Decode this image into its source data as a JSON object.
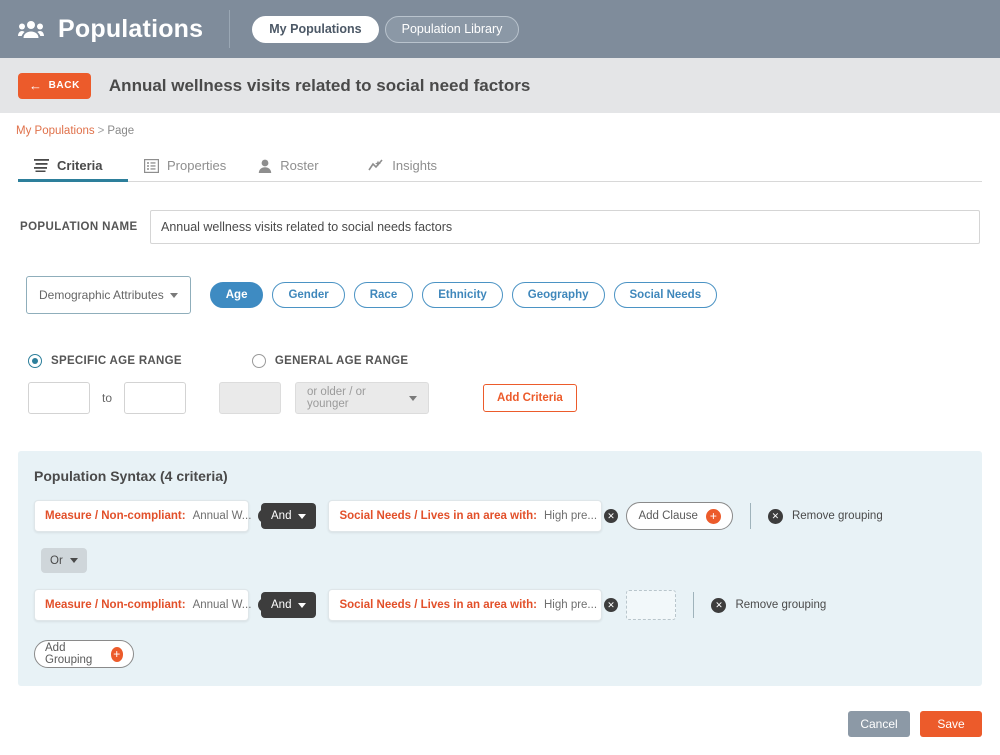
{
  "appbar": {
    "logo_icon": "people-group-icon",
    "title": "Populations",
    "segments": [
      {
        "label": "My Populations",
        "active": true
      },
      {
        "label": "Population Library",
        "active": false
      }
    ]
  },
  "subheader": {
    "back_label": "BACK",
    "back_icon": "arrow-left-icon",
    "page_title": "Annual wellness visits related to social need factors"
  },
  "breadcrumb": {
    "root": "My Populations",
    "separator": ">",
    "current": "Page"
  },
  "tabs": [
    {
      "label": "Criteria",
      "icon": "criteria-lines-icon",
      "active": true
    },
    {
      "label": "Properties",
      "icon": "list-box-icon",
      "active": false
    },
    {
      "label": "Roster",
      "icon": "person-icon",
      "active": false
    },
    {
      "label": "Insights",
      "icon": "trend-chart-icon",
      "active": false
    }
  ],
  "population_name": {
    "label": "POPULATION NAME",
    "value": "Annual wellness visits related to social needs factors",
    "placeholder": "Population name"
  },
  "attributes": {
    "selector_label": "Demographic  Attributes",
    "selector_icon": "chevron-down-icon",
    "pills": [
      {
        "label": "Age",
        "selected": true
      },
      {
        "label": "Gender",
        "selected": false
      },
      {
        "label": "Race",
        "selected": false
      },
      {
        "label": "Ethnicity",
        "selected": false
      },
      {
        "label": "Geography",
        "selected": false
      },
      {
        "label": "Social Needs",
        "selected": false
      }
    ]
  },
  "age_range": {
    "specific_label": "SPECIFIC AGE RANGE",
    "specific_selected": true,
    "general_label": "GENERAL AGE RANGE",
    "general_selected": false,
    "from_value": "",
    "from_placeholder": "",
    "to_label": "to",
    "to_value": "",
    "to_placeholder": "",
    "general_value": "",
    "general_select_label": "or older / or younger",
    "add_criteria_label": "Add Criteria"
  },
  "syntax": {
    "title": "Population Syntax (4 criteria)",
    "groups": [
      {
        "clauses": [
          {
            "category": "Measure / Non-compliant:",
            "value": "Annual W...",
            "remove_icon": "remove-circle-icon"
          },
          {
            "category": "Social Needs / Lives in an area with:",
            "value": "High pre...",
            "remove_icon": "remove-circle-icon"
          }
        ],
        "operator": "And",
        "operator_icon": "chevron-down-icon",
        "add_clause_label": "Add Clause",
        "add_clause_icon": "plus-circle-icon",
        "remove_grouping_label": "Remove grouping",
        "remove_grouping_icon": "remove-circle-icon",
        "has_drop_zone": false
      },
      {
        "clauses": [
          {
            "category": "Measure / Non-compliant:",
            "value": "Annual W...",
            "remove_icon": "remove-circle-icon"
          },
          {
            "category": "Social Needs / Lives in an area with:",
            "value": "High pre...",
            "remove_icon": "remove-circle-icon"
          }
        ],
        "operator": "And",
        "operator_icon": "chevron-down-icon",
        "remove_grouping_label": "Remove grouping",
        "remove_grouping_icon": "remove-circle-icon",
        "has_drop_zone": true
      }
    ],
    "group_connector": {
      "label": "Or",
      "icon": "chevron-down-icon"
    },
    "add_grouping_label": "Add Grouping",
    "add_grouping_icon": "plus-circle-icon"
  },
  "footer": {
    "cancel_label": "Cancel",
    "save_label": "Save"
  },
  "colors": {
    "appbar_bg": "#7f8c9b",
    "accent_orange": "#ec5b2b",
    "accent_blue": "#3e8bc2",
    "tab_underline": "#2d7f9b",
    "panel_bg": "#e8f2f6",
    "chip_category": "#e2502a"
  }
}
